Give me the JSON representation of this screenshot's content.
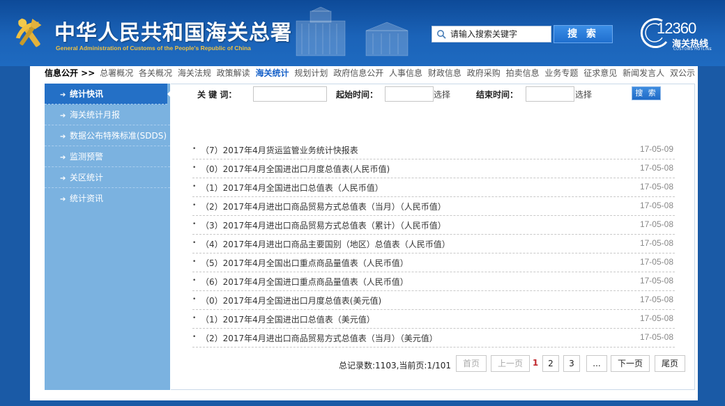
{
  "header": {
    "title_cn": "中华人民共和国海关总署",
    "title_en": "General Administration of Customs of the People's Republic of China",
    "search_placeholder": "请输入搜索关键字",
    "search_button": "搜 索",
    "hotline_number": "12360",
    "hotline_cn": "海关热线",
    "hotline_en": "CUSTOMS HOTLINE"
  },
  "nav": {
    "prefix": "信息公开 >>",
    "items": [
      {
        "label": "总署概况",
        "active": false
      },
      {
        "label": "各关概况",
        "active": false
      },
      {
        "label": "海关法规",
        "active": false
      },
      {
        "label": "政策解读",
        "active": false
      },
      {
        "label": "海关统计",
        "active": true
      },
      {
        "label": "规划计划",
        "active": false
      },
      {
        "label": "政府信息公开",
        "active": false
      },
      {
        "label": "人事信息",
        "active": false
      },
      {
        "label": "财政信息",
        "active": false
      },
      {
        "label": "政府采购",
        "active": false
      },
      {
        "label": "拍卖信息",
        "active": false
      },
      {
        "label": "业务专题",
        "active": false
      },
      {
        "label": "征求意见",
        "active": false
      },
      {
        "label": "新闻发言人",
        "active": false
      },
      {
        "label": "双公示",
        "active": false
      }
    ]
  },
  "sidebar": {
    "items": [
      {
        "label": "统计快讯",
        "active": true
      },
      {
        "label": "海关统计月报",
        "active": false
      },
      {
        "label": "数据公布特殊标准(SDDS)",
        "active": false
      },
      {
        "label": "监测预警",
        "active": false
      },
      {
        "label": "关区统计",
        "active": false
      },
      {
        "label": "统计资讯",
        "active": false
      }
    ]
  },
  "filter": {
    "keyword_label": "关 键 词：",
    "start_label": "起始时间：",
    "start_select": "选择",
    "end_label": "结束时间：",
    "end_select": "选择",
    "button": "搜 索"
  },
  "list": [
    {
      "title": "（7）2017年4月货运监管业务统计快报表",
      "date": "17-05-09"
    },
    {
      "title": "（0）2017年4月全国进出口月度总值表(人民币值)",
      "date": "17-05-08"
    },
    {
      "title": "（1）2017年4月全国进出口总值表（人民币值）",
      "date": "17-05-08"
    },
    {
      "title": "（2）2017年4月进出口商品贸易方式总值表（当月）（人民币值）",
      "date": "17-05-08"
    },
    {
      "title": "（3）2017年4月进出口商品贸易方式总值表（累计）（人民币值）",
      "date": "17-05-08"
    },
    {
      "title": "（4）2017年4月进出口商品主要国别（地区）总值表（人民币值）",
      "date": "17-05-08"
    },
    {
      "title": "（5）2017年4月全国出口重点商品量值表（人民币值）",
      "date": "17-05-08"
    },
    {
      "title": "（6）2017年4月全国进口重点商品量值表（人民币值）",
      "date": "17-05-08"
    },
    {
      "title": "（0）2017年4月全国进出口月度总值表(美元值)",
      "date": "17-05-08"
    },
    {
      "title": "（1）2017年4月全国进出口总值表（美元值）",
      "date": "17-05-08"
    },
    {
      "title": "（2）2017年4月进出口商品贸易方式总值表（当月）（美元值）",
      "date": "17-05-08"
    }
  ],
  "pagination": {
    "info": "总记录数:1103,当前页:1/101",
    "first": "首页",
    "prev": "上一页",
    "current": "1",
    "page2": "2",
    "page3": "3",
    "ellipsis": "...",
    "next": "下一页",
    "last": "尾页"
  }
}
